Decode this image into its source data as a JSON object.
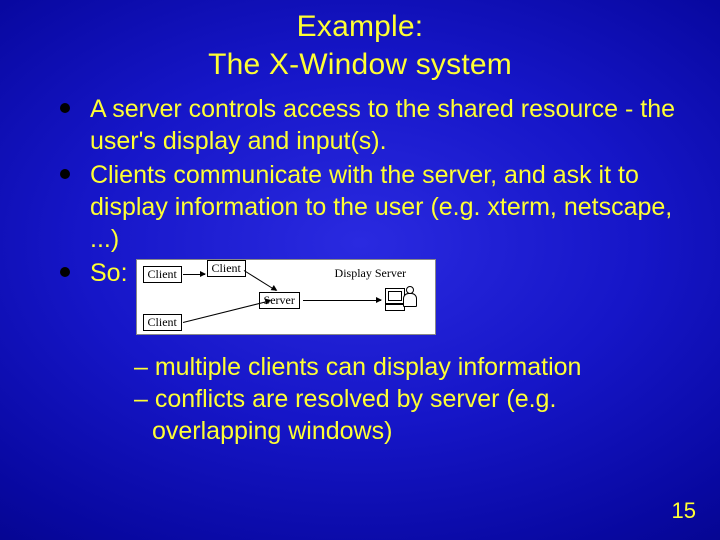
{
  "title_line1": "Example:",
  "title_line2": "The X-Window system",
  "bullets": [
    "A server controls access to the shared resource - the user's display and input(s).",
    "Clients communicate with the server, and ask it to display information to the user (e.g. xterm, netscape, ...)",
    "So:"
  ],
  "diagram": {
    "client_top": "Client",
    "client_mid": "Client",
    "client_bot": "Client",
    "server": "Server",
    "display_server": "Display Server"
  },
  "sub_points": [
    "– multiple clients can display information",
    "– conflicts are resolved by server (e.g. overlapping windows)"
  ],
  "slide_number": "15"
}
